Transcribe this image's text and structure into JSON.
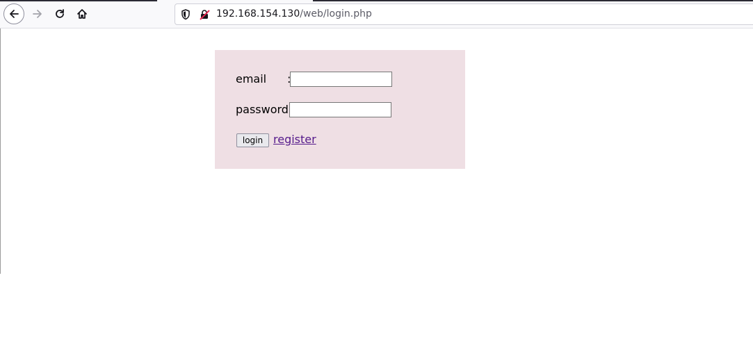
{
  "browser": {
    "url_host": "192.168.154.130",
    "url_path": "/web/login.php",
    "icons": {
      "back": "back-arrow-icon",
      "forward": "forward-arrow-icon",
      "reload": "reload-icon",
      "home": "home-icon",
      "tracking": "shield-icon",
      "insecure": "insecure-lock-icon"
    }
  },
  "login_form": {
    "email_label": "email",
    "email_colon": ":",
    "email_value": "",
    "password_label": "password:",
    "password_value": "",
    "login_button": "login",
    "register_link": "register",
    "colors": {
      "panel_background": "#efdfe4",
      "link": "#551a8b"
    }
  }
}
